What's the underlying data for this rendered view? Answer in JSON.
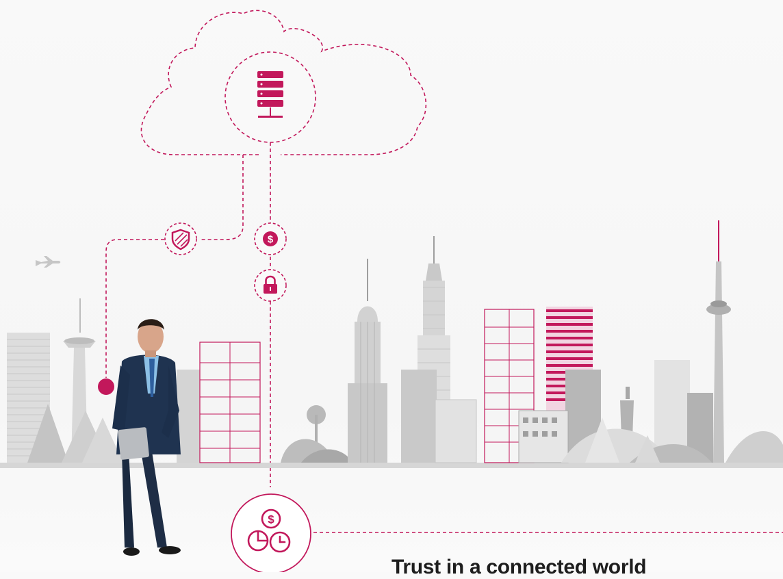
{
  "headline": "Trust in a connected world",
  "colors": {
    "accent": "#c2185b",
    "dash": "#c2185b",
    "skyline_light": "#d9d9d9",
    "skyline_mid": "#bdbdbd",
    "skyline_dark": "#9e9e9e"
  },
  "icons": [
    "cloud-icon",
    "server-stack-icon",
    "shield-icon",
    "dollar-coin-icon",
    "padlock-icon",
    "finance-chart-icon",
    "airplane-icon"
  ]
}
